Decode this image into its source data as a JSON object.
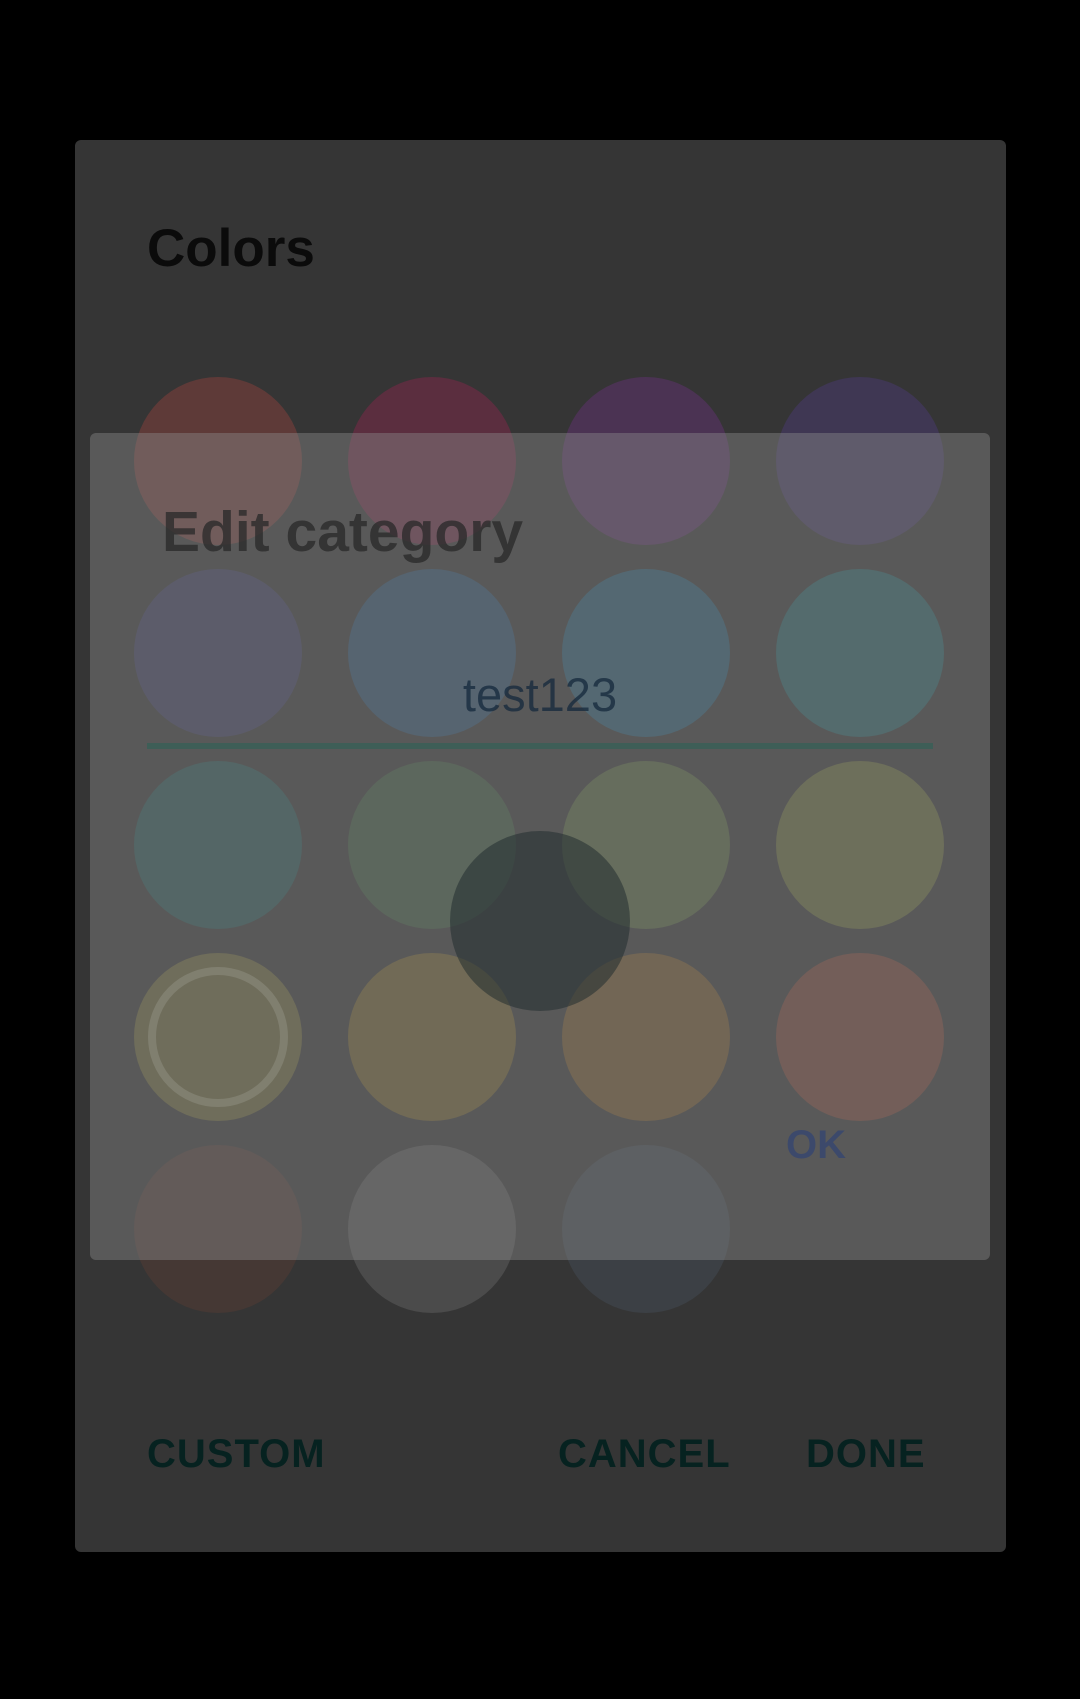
{
  "colors_dialog": {
    "title": "Colors",
    "swatches": [
      {
        "color": "#5e3a38",
        "selected": false
      },
      {
        "color": "#5b2e3f",
        "selected": false
      },
      {
        "color": "#4b3353",
        "selected": false
      },
      {
        "color": "#3f3753",
        "selected": false
      },
      {
        "color": "#3a3a52",
        "selected": false
      },
      {
        "color": "#30475c",
        "selected": false
      },
      {
        "color": "#2c4f5f",
        "selected": false
      },
      {
        "color": "#2b5356",
        "selected": false
      },
      {
        "color": "#2c4b4a",
        "selected": false
      },
      {
        "color": "#3a4d3b",
        "selected": false
      },
      {
        "color": "#4a563c",
        "selected": false
      },
      {
        "color": "#575a38",
        "selected": false
      },
      {
        "color": "#5a5737",
        "selected": true
      },
      {
        "color": "#5e5230",
        "selected": false
      },
      {
        "color": "#604b2d",
        "selected": false
      },
      {
        "color": "#613d34",
        "selected": false
      },
      {
        "color": "#453834",
        "selected": false
      },
      {
        "color": "#4b4b4b",
        "selected": false
      },
      {
        "color": "#3c4045",
        "selected": false
      }
    ],
    "actions": {
      "custom": "CUSTOM",
      "cancel": "CANCEL",
      "done": "DONE"
    }
  },
  "edit_dialog": {
    "title": "Edit category",
    "name_value": "test123",
    "ok": "OK",
    "preview_color": "#3a4448"
  },
  "theme": {
    "accent": "#3e5e57",
    "scrim": "#000000"
  }
}
